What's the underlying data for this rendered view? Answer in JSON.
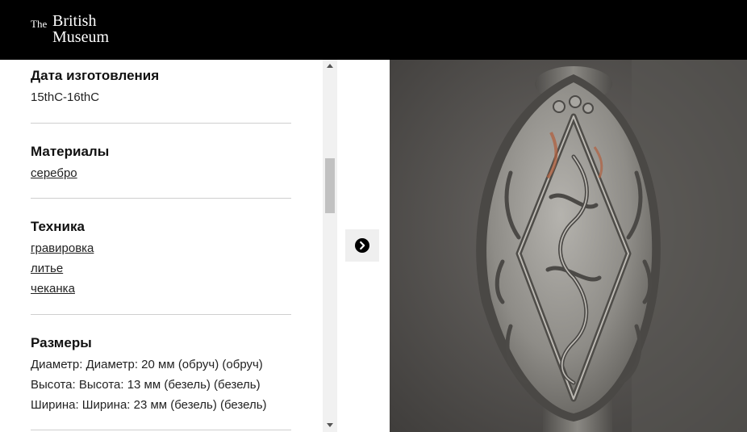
{
  "header": {
    "logo_the": "The",
    "logo_british": "British",
    "logo_museum": "Museum"
  },
  "details": {
    "date": {
      "heading": "Дата изготовления",
      "value": "15thC-16thC"
    },
    "materials": {
      "heading": "Материалы",
      "links": [
        "серебро"
      ]
    },
    "technique": {
      "heading": "Техника",
      "links": [
        "гравировка",
        "литье",
        "чеканка"
      ]
    },
    "dimensions": {
      "heading": "Размеры",
      "values": [
        "Диаметр: Диаметр: 20 мм (обруч) (обруч)",
        "Высота: Высота: 13 мм (безель) (безель)",
        "Ширина: Ширина: 23 мм (безель) (безель)"
      ]
    }
  },
  "icons": {
    "next": "chevron-right-icon",
    "scroll_up": "triangle-up-icon",
    "scroll_down": "triangle-down-icon"
  },
  "colors": {
    "header_bg": "#000000",
    "nav_panel_bg": "#efefef",
    "ring_metal": "#9a9895",
    "background_stone": "#5b5856"
  }
}
